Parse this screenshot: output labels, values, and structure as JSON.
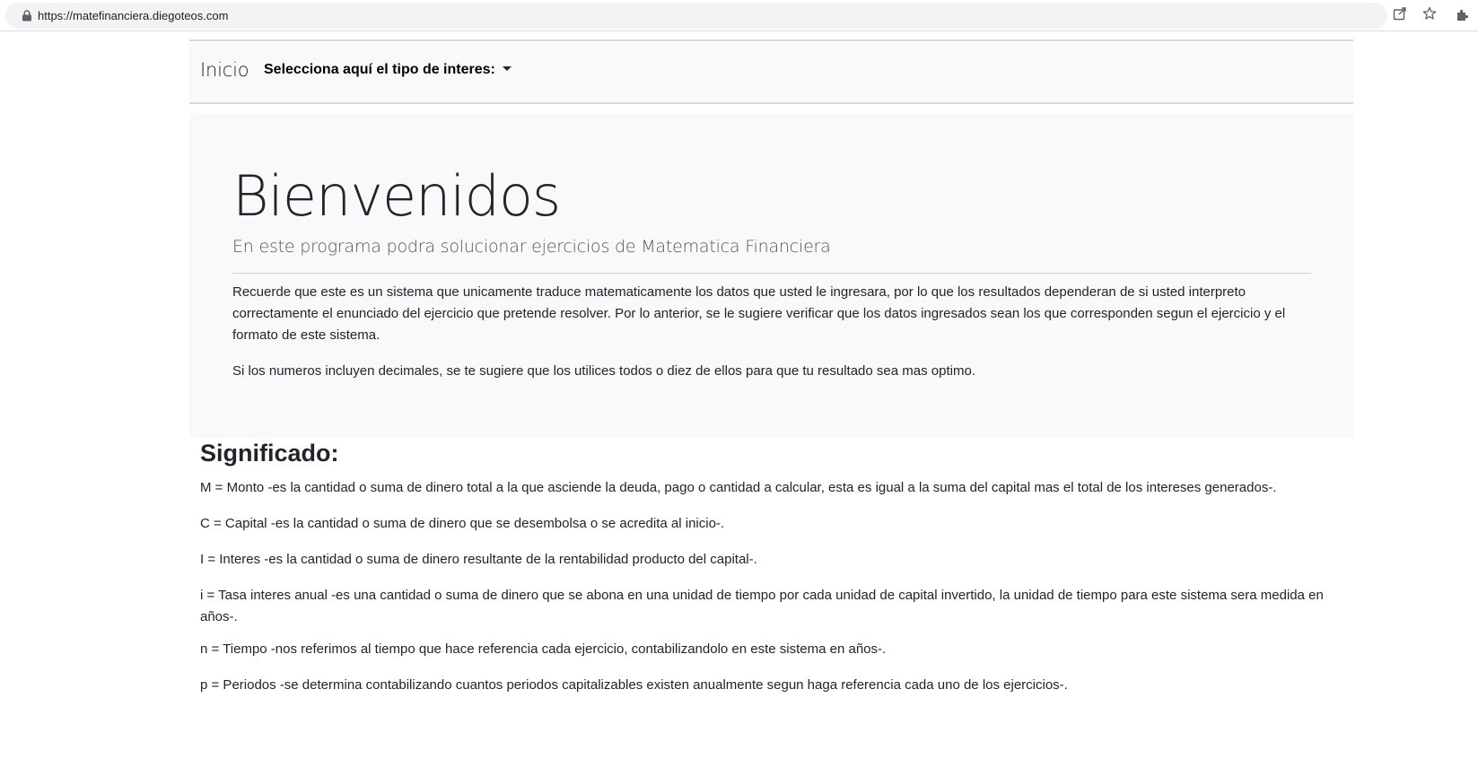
{
  "browser": {
    "url": "https://matefinanciera.diegoteos.com"
  },
  "navbar": {
    "brand": "Inicio",
    "dropdown_label": "Selecciona aquí el tipo de interes:"
  },
  "jumbotron": {
    "title": "Bienvenidos",
    "lead": "En este programa podra solucionar ejercicios de Matematica Financiera",
    "paragraph_1": "Recuerde que este es un sistema que unicamente traduce matematicamente los datos que usted le ingresara, por lo que los resultados dependeran de si usted interpreto correctamente el enunciado del ejercicio que pretende resolver. Por lo anterior, se le sugiere verificar que los datos ingresados sean los que corresponden segun el ejercicio y el formato de este sistema.",
    "paragraph_2": "Si los numeros incluyen decimales, se te sugiere que los utilices todos o diez de ellos para que tu resultado sea mas optimo."
  },
  "significado": {
    "title": "Significado:",
    "definitions": [
      "M = Monto -es la cantidad o suma de dinero total a la que asciende la deuda, pago o cantidad a calcular, esta es igual a la suma del capital mas el total de los intereses generados-.",
      "C = Capital -es la cantidad o suma de dinero que se desembolsa o se acredita al inicio-.",
      "I = Interes -es la cantidad o suma de dinero resultante de la rentabilidad producto del capital-.",
      "i = Tasa interes anual -es una cantidad o suma de dinero que se abona en una unidad de tiempo por cada unidad de capital invertido, la unidad de tiempo para este sistema sera medida en años-.",
      "n = Tiempo -nos referimos al tiempo que hace referencia cada ejercicio, contabilizandolo en este sistema en años-.",
      "p = Periodos -se determina contabilizando cuantos periodos capitalizables existen anualmente segun haga referencia cada uno de los ejercicios-."
    ]
  },
  "icons": [
    "lock-icon",
    "share-icon",
    "star-icon",
    "extensions-icon",
    "caret-down-icon"
  ]
}
